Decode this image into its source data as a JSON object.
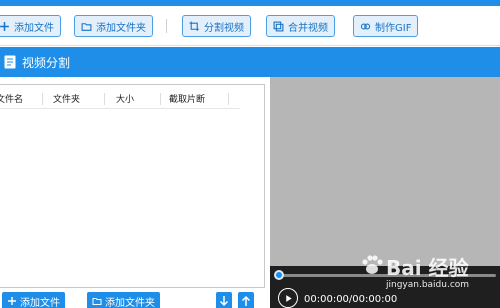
{
  "toolbar": {
    "add_file": "添加文件",
    "add_folder": "添加文件夹",
    "split_video": "分割视频",
    "merge_video": "合并视频",
    "make_gif": "制作GIF"
  },
  "section": {
    "title": "视频分割"
  },
  "file_list": {
    "columns": [
      "文件名",
      "文件夹",
      "大小",
      "截取片断"
    ]
  },
  "bottom": {
    "add_file": "添加文件",
    "add_folder": "添加文件夹"
  },
  "player": {
    "time": "00:00:00/00:00:00"
  },
  "watermark": {
    "logo": "Bai 经验",
    "url": "jingyan.baidu.com"
  },
  "colors": {
    "accent": "#1e8ee9",
    "video_bg": "#b6b6b6",
    "controls_bg": "#1f1f1f"
  }
}
